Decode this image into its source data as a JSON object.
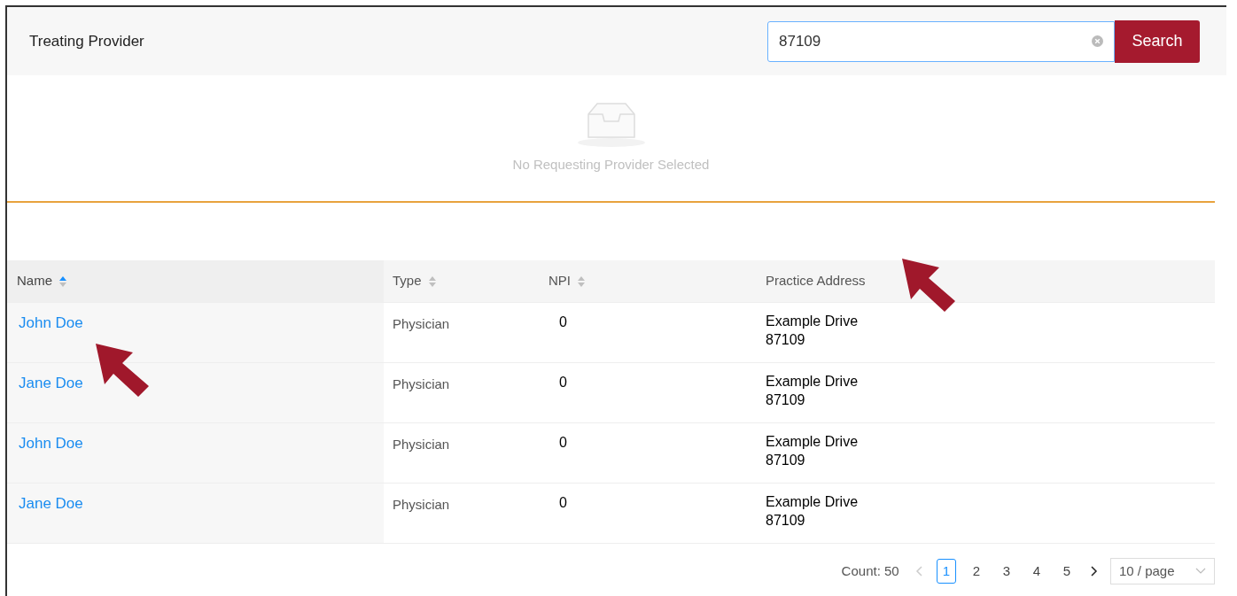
{
  "header": {
    "title": "Treating Provider"
  },
  "search": {
    "value": "87109",
    "button": "Search"
  },
  "empty_state": {
    "message": "No Requesting Provider Selected"
  },
  "table": {
    "columns": [
      {
        "label": "Name",
        "sortable": true,
        "sorted": true
      },
      {
        "label": "Type",
        "sortable": true,
        "sorted": false
      },
      {
        "label": "NPI",
        "sortable": true,
        "sorted": false
      },
      {
        "label": "Practice Address",
        "sortable": false
      }
    ],
    "rows": [
      {
        "name": "John Doe",
        "type": "Physician",
        "npi": "0",
        "address": [
          "Example Drive",
          "87109"
        ]
      },
      {
        "name": "Jane Doe",
        "type": "Physician",
        "npi": "0",
        "address": [
          "Example Drive",
          "87109"
        ]
      },
      {
        "name": "John Doe",
        "type": "Physician",
        "npi": "0",
        "address": [
          "Example Drive",
          "87109"
        ]
      },
      {
        "name": "Jane Doe",
        "type": "Physician",
        "npi": "0",
        "address": [
          "Example Drive",
          "87109"
        ]
      }
    ]
  },
  "pagination": {
    "count": "Count: 50",
    "prev_disabled": true,
    "next_disabled": false,
    "pages": [
      {
        "label": "1",
        "selected": true
      },
      {
        "label": "2",
        "selected": false
      },
      {
        "label": "3",
        "selected": false
      },
      {
        "label": "4",
        "selected": false
      },
      {
        "label": "5",
        "selected": false
      }
    ],
    "page_size": "10 / page"
  }
}
